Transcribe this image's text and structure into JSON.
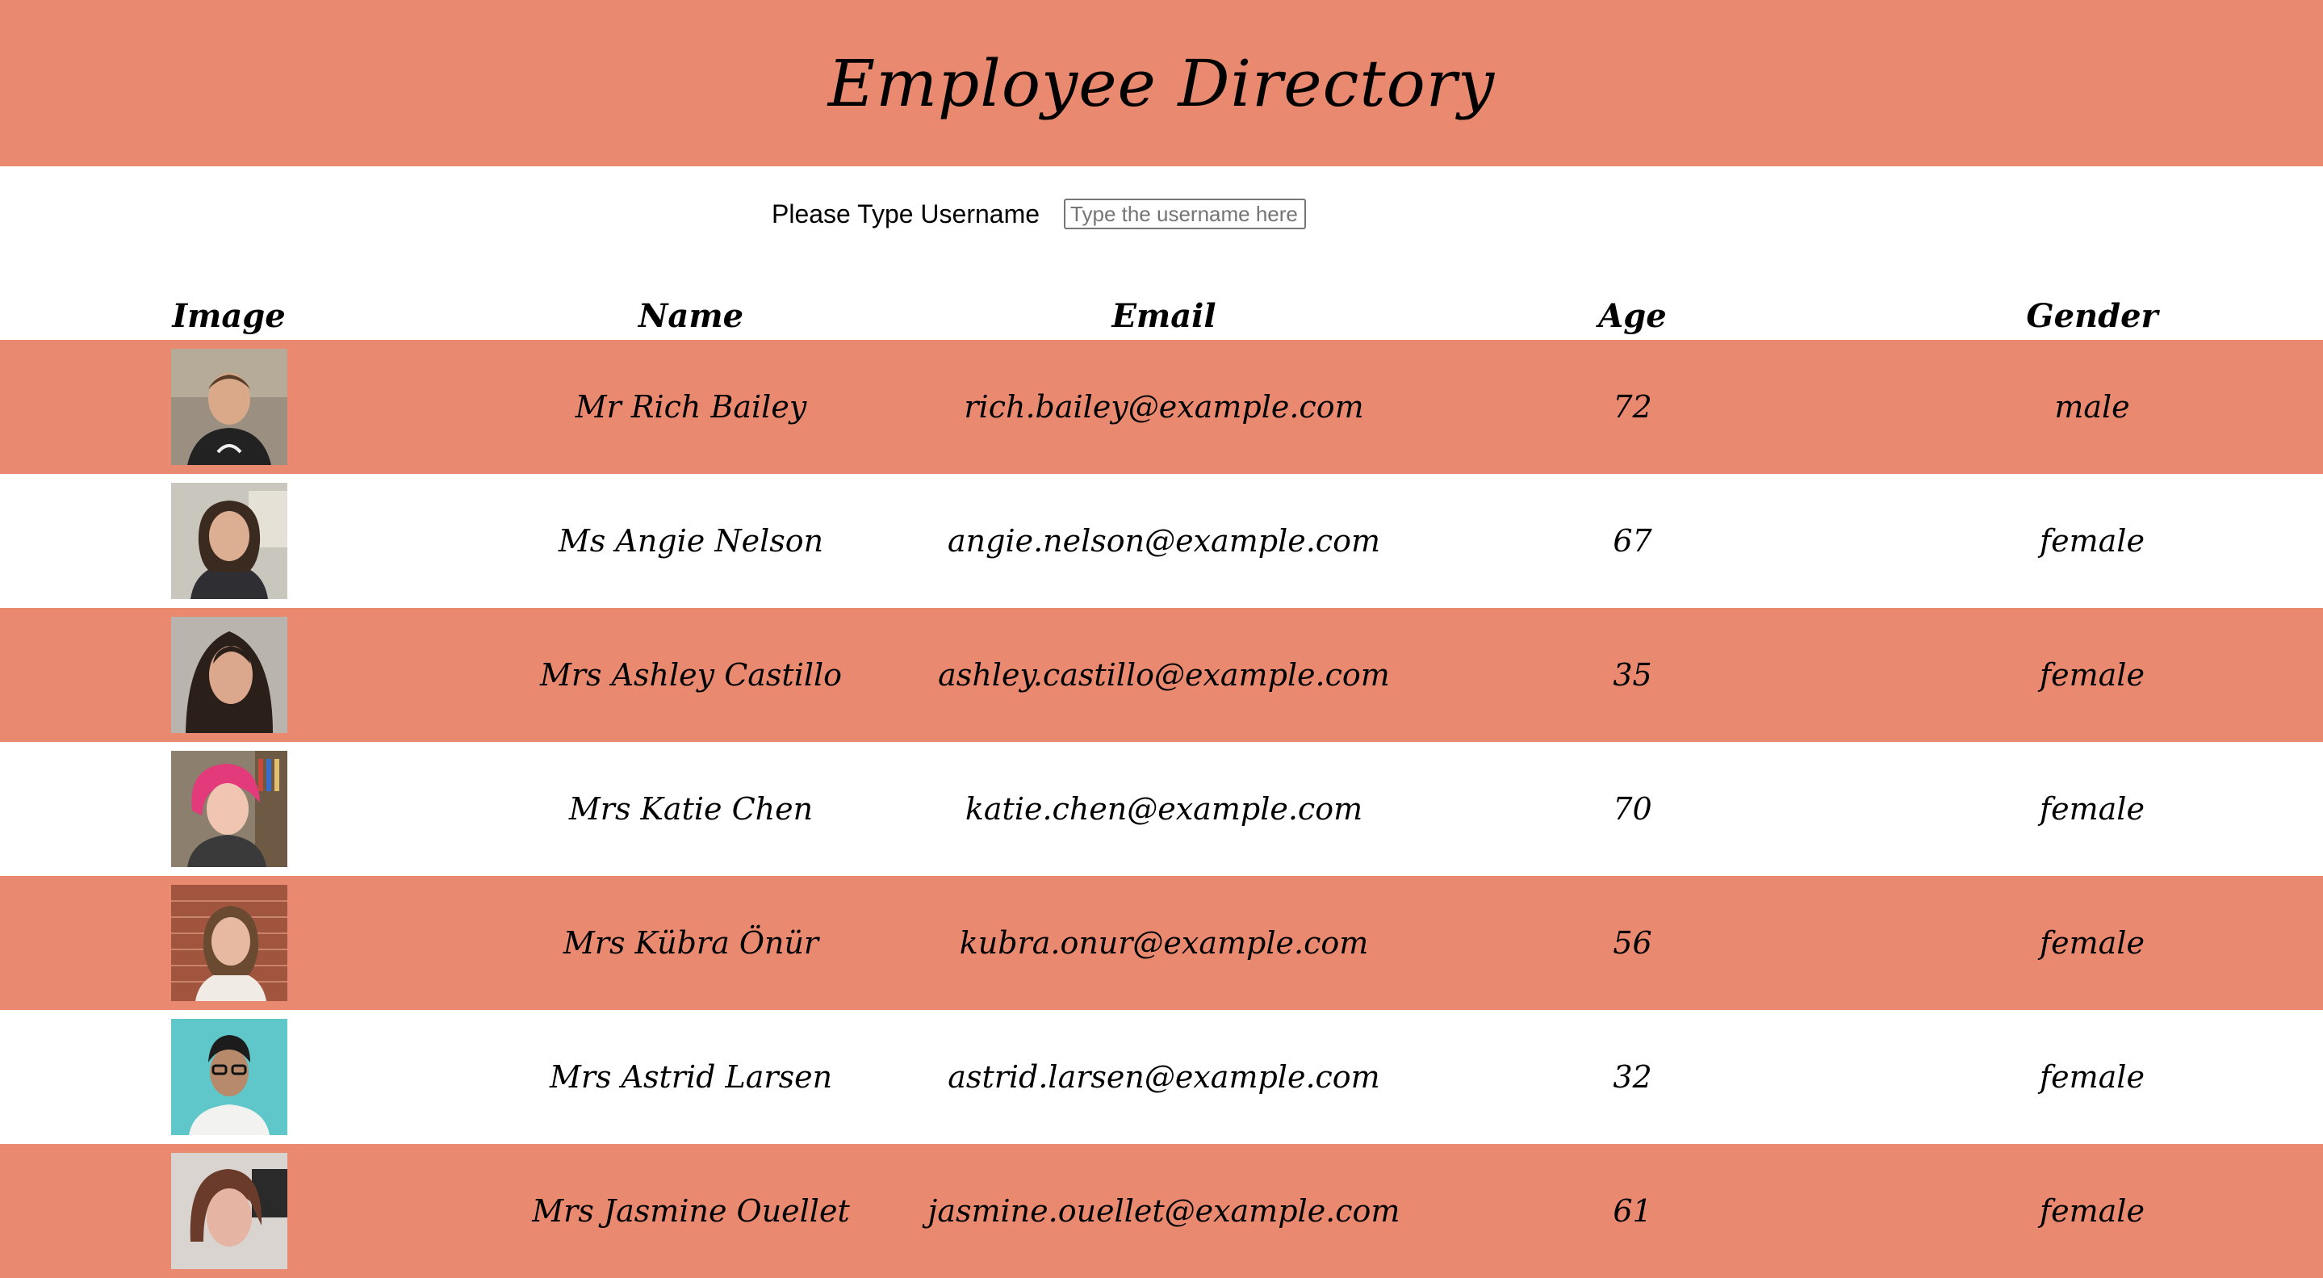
{
  "header": {
    "title": "Employee Directory"
  },
  "search": {
    "label": "Please Type Username",
    "placeholder": "Type the username here",
    "value": ""
  },
  "table": {
    "columns": [
      "Image",
      "Name",
      "Email",
      "Age",
      "Gender"
    ],
    "rows": [
      {
        "name": "Mr Rich Bailey",
        "email": "rich.bailey@example.com",
        "age": "72",
        "gender": "male"
      },
      {
        "name": "Ms Angie Nelson",
        "email": "angie.nelson@example.com",
        "age": "67",
        "gender": "female"
      },
      {
        "name": "Mrs Ashley Castillo",
        "email": "ashley.castillo@example.com",
        "age": "35",
        "gender": "female"
      },
      {
        "name": "Mrs Katie Chen",
        "email": "katie.chen@example.com",
        "age": "70",
        "gender": "female"
      },
      {
        "name": "Mrs Kübra Önür",
        "email": "kubra.onur@example.com",
        "age": "56",
        "gender": "female"
      },
      {
        "name": "Mrs Astrid Larsen",
        "email": "astrid.larsen@example.com",
        "age": "32",
        "gender": "female"
      },
      {
        "name": "Mrs Jasmine Ouellet",
        "email": "jasmine.ouellet@example.com",
        "age": "61",
        "gender": "female"
      }
    ]
  },
  "colors": {
    "accent": "#e9896f",
    "row_alt": "#ffffff"
  }
}
